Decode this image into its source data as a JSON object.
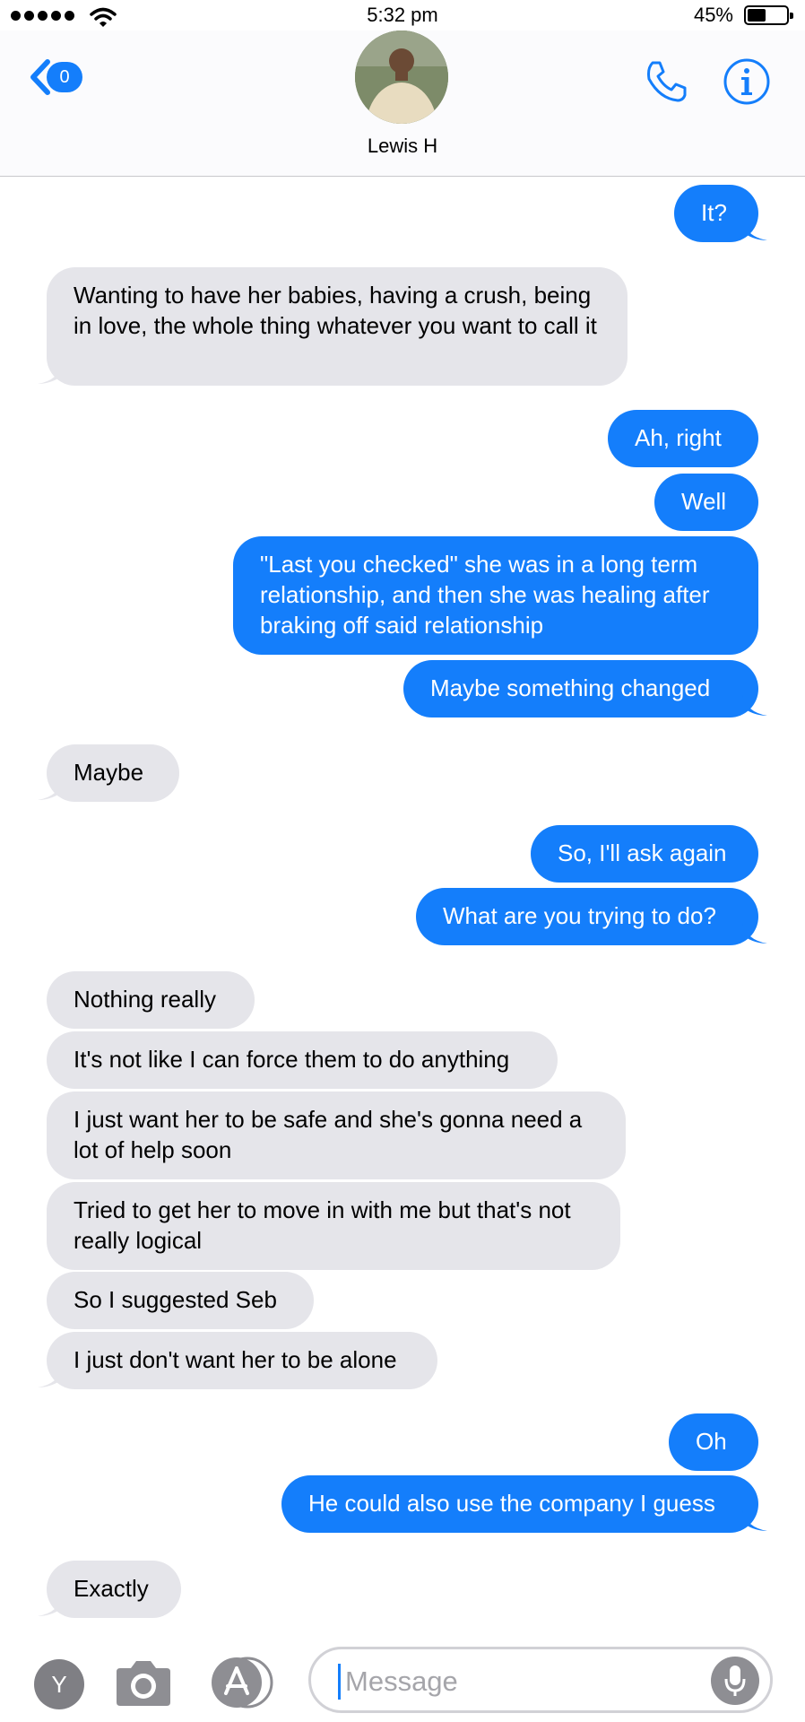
{
  "status_bar": {
    "time": "5:32 pm",
    "battery": "45%"
  },
  "header": {
    "back_count": "0",
    "contact_name": "Lewis H"
  },
  "messages": [
    {
      "text": "It?",
      "dir": "out"
    },
    {
      "text": "Wanting to have her babies, having a crush, being in love, the whole thing whatever you want to call it",
      "dir": "in"
    },
    {
      "text": "Ah, right",
      "dir": "out"
    },
    {
      "text": "Well",
      "dir": "out"
    },
    {
      "text": "\"Last you checked\" she was in a long term relationship, and then she was healing after braking off said relationship",
      "dir": "out"
    },
    {
      "text": "Maybe something changed",
      "dir": "out"
    },
    {
      "text": "Maybe",
      "dir": "in"
    },
    {
      "text": "So, I'll ask again",
      "dir": "out"
    },
    {
      "text": "What are you trying to do?",
      "dir": "out"
    },
    {
      "text": "Nothing really",
      "dir": "in"
    },
    {
      "text": "It's not like I can force them to do anything",
      "dir": "in"
    },
    {
      "text": "I just want her to be safe and she's gonna need a lot of help soon",
      "dir": "in"
    },
    {
      "text": "Tried to get her to move in with me but that's not really logical",
      "dir": "in"
    },
    {
      "text": "So I suggested Seb",
      "dir": "in"
    },
    {
      "text": "I just don't want her to be alone",
      "dir": "in"
    },
    {
      "text": "Oh",
      "dir": "out"
    },
    {
      "text": "He could also use the company I guess",
      "dir": "out"
    },
    {
      "text": "Exactly",
      "dir": "in"
    }
  ],
  "input_bar": {
    "apps_label": "Y",
    "placeholder": "Message"
  },
  "colors": {
    "accent": "#147efb",
    "incoming": "#e5e5ea"
  }
}
